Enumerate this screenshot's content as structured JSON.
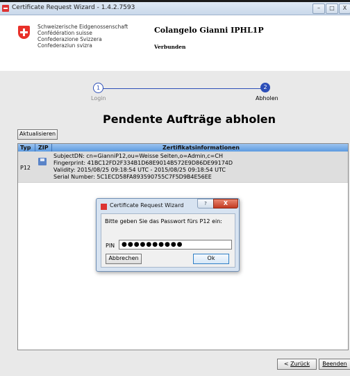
{
  "window": {
    "title": "Certificate Request Wizard - 1.4.2.7593",
    "minimize": "–",
    "maximize": "□",
    "close": "X"
  },
  "header": {
    "federation_lines": [
      "Schweizerische Eidgenossenschaft",
      "Confédération suisse",
      "Confederazione Svizzera",
      "Confederaziun svizra"
    ],
    "user_name": "Colangelo Gianni IPHL1P",
    "connection_status": "Verbunden"
  },
  "stepper": {
    "steps": [
      {
        "number": "1",
        "label": "Login",
        "active": false
      },
      {
        "number": "2",
        "label": "Abholen",
        "active": true
      }
    ]
  },
  "main": {
    "title": "Pendente Aufträge abholen",
    "refresh_label": "Aktualisieren",
    "table": {
      "columns": [
        "Typ",
        "ZIP",
        "Zertifikatsinformationen"
      ],
      "rows": [
        {
          "type": "P12",
          "zip_icon": "disk-icon",
          "info": [
            "SubjectDN: cn=GianniP12,ou=Weisse Seiten,o=Admin,c=CH",
            "Fingerprint: 41BC12FD2F334B1D68E9014B572E9D86DE99174D",
            "Validity: 2015/08/25 09:18:54 UTC - 2015/08/25 09:18:54 UTC",
            "Serial Number: 5C1ECD58FA893590755C7F5D9B4E56EE"
          ]
        }
      ]
    }
  },
  "dialog": {
    "title": "Certificate Request Wizard",
    "help": "?",
    "close": "X",
    "message": "Bitte geben Sie das Passwort fürs P12 ein:",
    "pin_label": "PIN",
    "pin_value": "●●●●●●●●●●",
    "cancel_label": "Abbrechen",
    "ok_label": "Ok"
  },
  "footer": {
    "back_prefix": "< ",
    "back_label": "Zurück",
    "finish_label": "Beenden"
  },
  "colors": {
    "accent": "#2d4fb8",
    "table_header": "#5d9be0",
    "swiss_red": "#e8312a"
  }
}
